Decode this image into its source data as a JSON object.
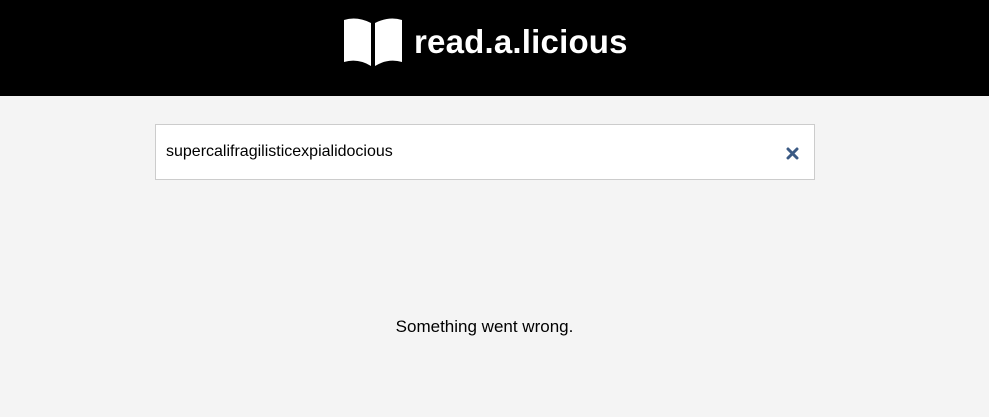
{
  "header": {
    "logo_icon": "open-book-icon",
    "brand_name": "read.a.licious",
    "background_color": "#000000",
    "text_color": "#ffffff"
  },
  "search": {
    "value": "supercalifragilisticexpialidocious",
    "placeholder": "",
    "clear_icon": "close-icon",
    "clear_icon_color": "#3b5a84"
  },
  "main": {
    "background_color": "#f4f4f4",
    "error_message": "Something went wrong."
  }
}
